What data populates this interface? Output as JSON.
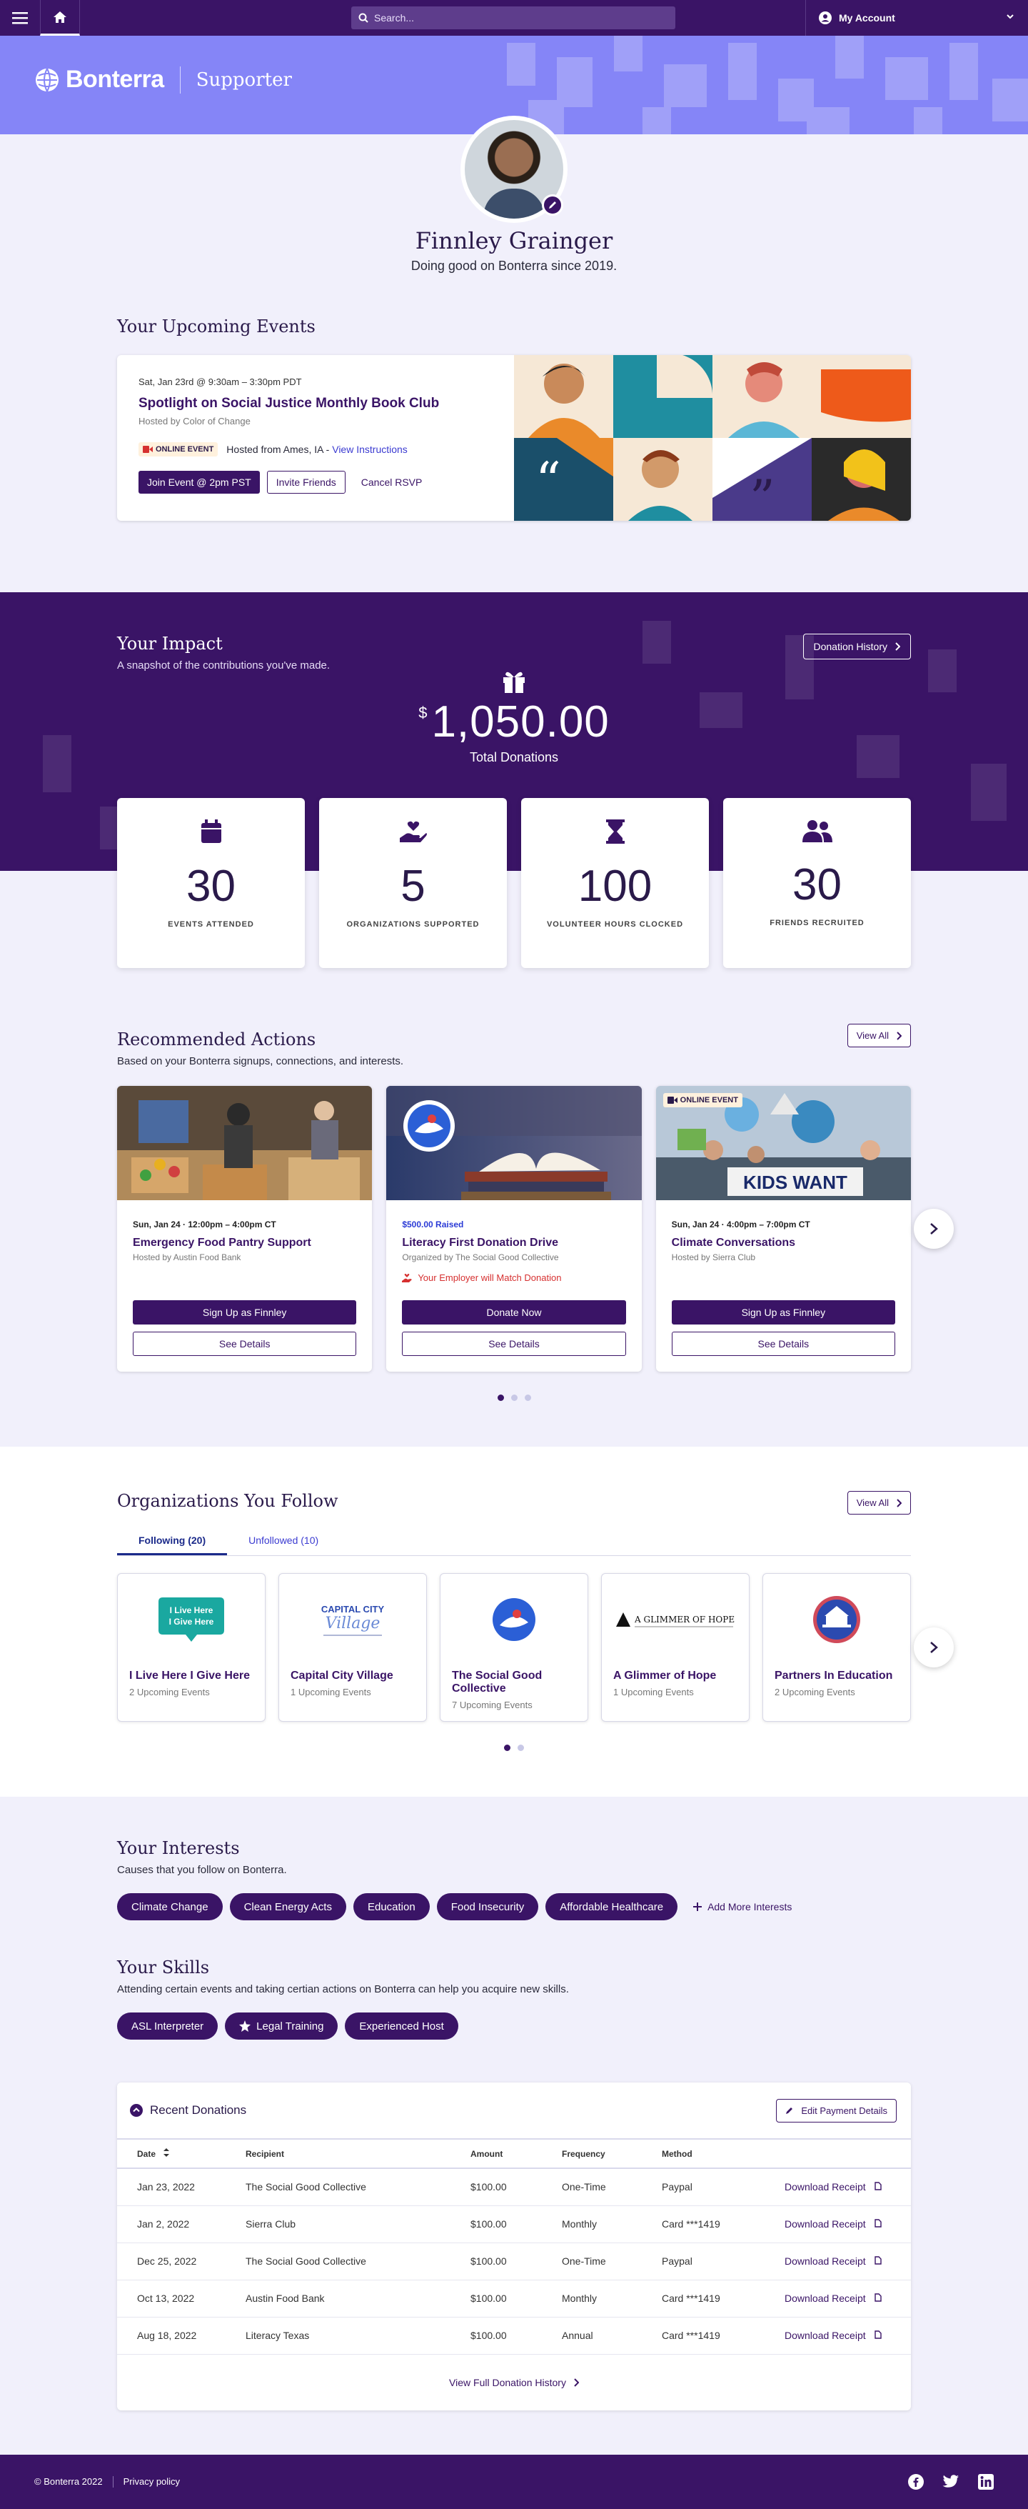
{
  "topbar": {
    "search_placeholder": "Search...",
    "account_label": "My Account"
  },
  "banner": {
    "brand": "Bonterra",
    "section": "Supporter"
  },
  "profile": {
    "name": "Finnley Grainger",
    "tagline": "Doing good on Bonterra since 2019."
  },
  "upcoming": {
    "heading": "Your Upcoming Events",
    "event": {
      "date": "Sat, Jan 23rd @ 9:30am – 3:30pm PDT",
      "title": "Spotlight on Social Justice Monthly Book Club",
      "host": "Hosted by Color of Change",
      "badge": "ONLINE EVENT",
      "location": "Hosted from Ames, IA - ",
      "instructions": "View Instructions",
      "join": "Join Event @ 2pm PST",
      "invite": "Invite Friends",
      "cancel": "Cancel RSVP"
    }
  },
  "impact": {
    "heading": "Your Impact",
    "subtitle": "A snapshot of the contributions you've made.",
    "history_button": "Donation History",
    "currency": "$",
    "amount": "1,050.00",
    "amount_label": "Total Donations",
    "stats": [
      {
        "value": "30",
        "label": "EVENTS ATTENDED",
        "icon": "calendar-icon"
      },
      {
        "value": "5",
        "label": "ORGANIZATIONS SUPPORTED",
        "icon": "heart-hand-icon"
      },
      {
        "value": "100",
        "label": "VOLUNTEER HOURS CLOCKED",
        "icon": "hourglass-icon"
      },
      {
        "value": "30",
        "label": "FRIENDS RECRUITED",
        "icon": "users-icon"
      }
    ]
  },
  "recommended": {
    "heading": "Recommended Actions",
    "subtitle": "Based on your Bonterra signups, connections, and interests.",
    "view_all": "View All",
    "cards": [
      {
        "meta": "Sun, Jan 24 · 12:00pm – 4:00pm CT",
        "title": "Emergency Food Pantry Support",
        "host": "Hosted by Austin Food Bank",
        "primary": "Sign Up as Finnley",
        "secondary": "See Details"
      },
      {
        "meta": "$500.00 Raised",
        "title": "Literacy First Donation Drive",
        "host": "Organized by The Social Good Collective",
        "match": "Your Employer will Match Donation",
        "primary": "Donate Now",
        "secondary": "See Details"
      },
      {
        "meta": "Sun, Jan 24 · 4:00pm – 7:00pm CT",
        "title": "Climate Conversations",
        "host": "Hosted by Sierra Club",
        "badge": "ONLINE EVENT",
        "sign": "KIDS WANT",
        "primary": "Sign Up as Finnley",
        "secondary": "See Details"
      }
    ]
  },
  "orgs": {
    "heading": "Organizations You Follow",
    "view_all": "View All",
    "tab_following": "Following (20)",
    "tab_unfollowed": "Unfollowed (10)",
    "items": [
      {
        "name": "I Live Here I Give Here",
        "count": "2 Upcoming Events",
        "logo_text": "I Live Here I Give Here"
      },
      {
        "name": "Capital City Village",
        "count": "1 Upcoming Events",
        "logo_text": "CAPITAL CITY Village"
      },
      {
        "name": "The Social Good Collective",
        "count": "7 Upcoming Events"
      },
      {
        "name": "A Glimmer of Hope",
        "count": "1 Upcoming Events",
        "logo_text": "A GLIMMER OF HOPE"
      },
      {
        "name": "Partners In Education",
        "count": "2 Upcoming Events"
      }
    ]
  },
  "interests": {
    "heading": "Your Interests",
    "subtitle": "Causes that you follow on Bonterra.",
    "items": [
      "Climate Change",
      "Clean Energy Acts",
      "Education",
      "Food Insecurity",
      "Affordable Healthcare"
    ],
    "add": "Add More Interests"
  },
  "skills": {
    "heading": "Your Skills",
    "subtitle": "Attending certain events and taking certian actions on Bonterra can help you acquire new skills.",
    "items": [
      "ASL Interpreter",
      "Legal Training",
      "Experienced Host"
    ]
  },
  "donations": {
    "heading": "Recent Donations",
    "edit": "Edit Payment Details",
    "columns": [
      "Date",
      "Recipient",
      "Amount",
      "Frequency",
      "Method"
    ],
    "rows": [
      {
        "date": "Jan 23, 2022",
        "recipient": "The Social Good Collective",
        "amount": "$100.00",
        "frequency": "One-Time",
        "method": "Paypal",
        "receipt": "Download Receipt"
      },
      {
        "date": "Jan 2, 2022",
        "recipient": "Sierra Club",
        "amount": "$100.00",
        "frequency": "Monthly",
        "method": "Card ***1419",
        "receipt": "Download Receipt"
      },
      {
        "date": "Dec 25, 2022",
        "recipient": "The Social Good Collective",
        "amount": "$100.00",
        "frequency": "One-Time",
        "method": "Paypal",
        "receipt": "Download Receipt"
      },
      {
        "date": "Oct 13, 2022",
        "recipient": "Austin Food Bank",
        "amount": "$100.00",
        "frequency": "Monthly",
        "method": "Card ***1419",
        "receipt": "Download Receipt"
      },
      {
        "date": "Aug 18, 2022",
        "recipient": "Literacy Texas",
        "amount": "$100.00",
        "frequency": "Annual",
        "method": "Card ***1419",
        "receipt": "Download Receipt"
      }
    ],
    "full_history": "View Full Donation History"
  },
  "footer": {
    "copyright": "© Bonterra 2022",
    "privacy": "Privacy policy"
  },
  "colors": {
    "primary": "#3a1466",
    "banner": "#8585f7",
    "link": "#3b3bd1",
    "alert": "#d63030"
  }
}
